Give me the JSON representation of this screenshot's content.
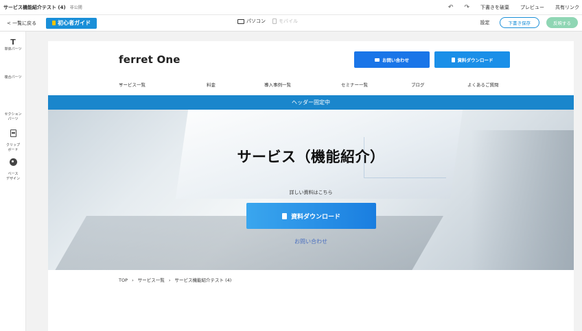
{
  "topbar": {
    "title": "サービス機能紹介テスト (4)",
    "status": "非公開",
    "undo_icon": "undo-icon",
    "redo_icon": "redo-icon",
    "discard_label": "下書きを破棄",
    "preview_label": "プレビュー",
    "share_label": "共有リンク"
  },
  "subbar": {
    "back_label": "< 一覧に戻る",
    "guide_label": "初心者ガイド",
    "pc_label": "パソコン",
    "mobile_label": "モバイル",
    "settings_label": "設定",
    "save_label": "下書き保存",
    "publish_label": "反映する"
  },
  "sidebar": {
    "items": [
      {
        "label": "単体パーツ",
        "icon": "text-icon"
      },
      {
        "label": "複合パーツ",
        "icon": "grid-icon"
      },
      {
        "label": "セクション\nパーツ",
        "icon": "section-icon"
      },
      {
        "label": "クリップ\nボード",
        "icon": "clipboard-icon"
      },
      {
        "label": "ベース\nデザイン",
        "icon": "palette-icon"
      }
    ]
  },
  "site": {
    "logo": "ferret One",
    "contact_button": "お問い合わせ",
    "download_button": "資料ダウンロード",
    "nav": [
      {
        "label": "サービス一覧",
        "dropdown": true
      },
      {
        "label": "料金",
        "dropdown": false
      },
      {
        "label": "導入事例一覧",
        "dropdown": true
      },
      {
        "label": "セミナー一覧",
        "dropdown": false
      },
      {
        "label": "ブログ",
        "dropdown": false
      },
      {
        "label": "よくあるご質問",
        "dropdown": false
      }
    ],
    "fixed_header_label": "ヘッダー固定中",
    "hero": {
      "title": "サービス（機能紹介）",
      "subtitle": "詳しい資料はこちら",
      "button": "資料ダウンロード",
      "link": "お問い合わせ"
    },
    "breadcrumb": [
      "TOP",
      "›",
      "サービス一覧",
      "›",
      "サービス機能紹介テスト (4)"
    ]
  },
  "colors": {
    "primary": "#1a8fd8",
    "fixed_bar": "#1a86cc",
    "publish": "#8fd6b4"
  }
}
